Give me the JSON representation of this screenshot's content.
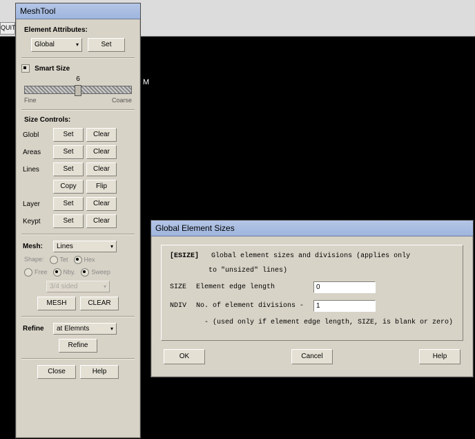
{
  "quit_label": "QUIT",
  "stray_m": "M",
  "meshtool": {
    "title": "MeshTool",
    "ea_label": "Element Attributes:",
    "ea_dropdown": "Global",
    "ea_set": "Set",
    "smart_size_label": "Smart Size",
    "smart_size_value": "6",
    "smart_fine": "Fine",
    "smart_coarse": "Coarse",
    "sc_label": "Size Controls:",
    "row_globl": "Globl",
    "row_areas": "Areas",
    "row_lines": "Lines",
    "row_layer": "Layer",
    "row_keypt": "Keypt",
    "btn_set": "Set",
    "btn_clear": "Clear",
    "btn_copy": "Copy",
    "btn_flip": "Flip",
    "mesh_label": "Mesh:",
    "mesh_dropdown": "Lines",
    "shape_label": "Shape:",
    "shape_tet": "Tet",
    "shape_hex": "Hex",
    "opt_free": "Free",
    "opt_mapped": "Nby.",
    "opt_sweep": "Sweep",
    "sided_dropdown": "3/4 sided",
    "btn_mesh": "MESH",
    "btn_clear_caps": "CLEAR",
    "refine_label": "Refine",
    "refine_dropdown": "at Elemnts",
    "btn_refine": "Refine",
    "btn_close": "Close",
    "btn_help": "Help"
  },
  "ges": {
    "title": "Global Element Sizes",
    "line1a": "[ESIZE]",
    "line1b": "Global element sizes and divisions (applies only",
    "line1c": "to \"unsized\" lines)",
    "size_label": "SIZE",
    "size_desc": "Element edge length",
    "size_value": "0",
    "ndiv_label": "NDIV",
    "ndiv_desc": "No. of element divisions -",
    "ndiv_value": "1",
    "note": "- (used only if element edge length, SIZE, is blank or zero)",
    "btn_ok": "OK",
    "btn_cancel": "Cancel",
    "btn_help": "Help"
  }
}
